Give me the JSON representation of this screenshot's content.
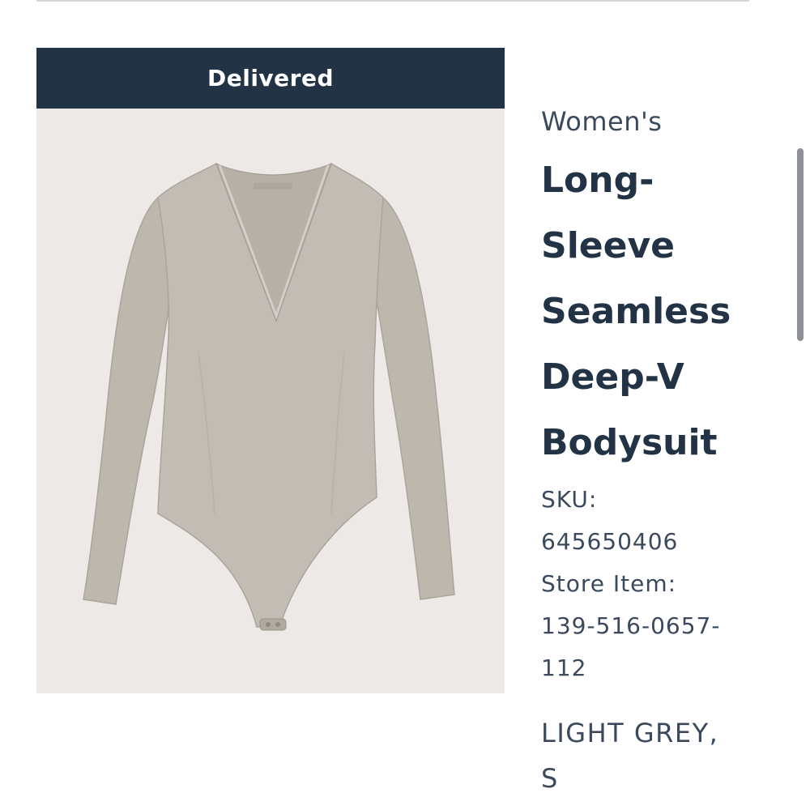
{
  "status_banner": {
    "label": "Delivered",
    "color": "#233346"
  },
  "product_image": {
    "description_icon": "bodysuit-image",
    "garment_color": "#bfb9b1",
    "background_color": "#ece9e6"
  },
  "product": {
    "category": "Women's",
    "title_lines": [
      "Long-",
      "Sleeve",
      "Seamless",
      "Deep-V",
      "Bodysuit"
    ],
    "sku_label": "SKU:",
    "sku_value": "645650406",
    "store_item_label": "Store Item:",
    "store_item_value_lines": [
      "139-516-0657-",
      "112"
    ],
    "variant_lines": [
      "LIGHT GREY,",
      "S"
    ]
  },
  "colors": {
    "text_primary": "#233346",
    "text_secondary": "#3a4a5c"
  }
}
